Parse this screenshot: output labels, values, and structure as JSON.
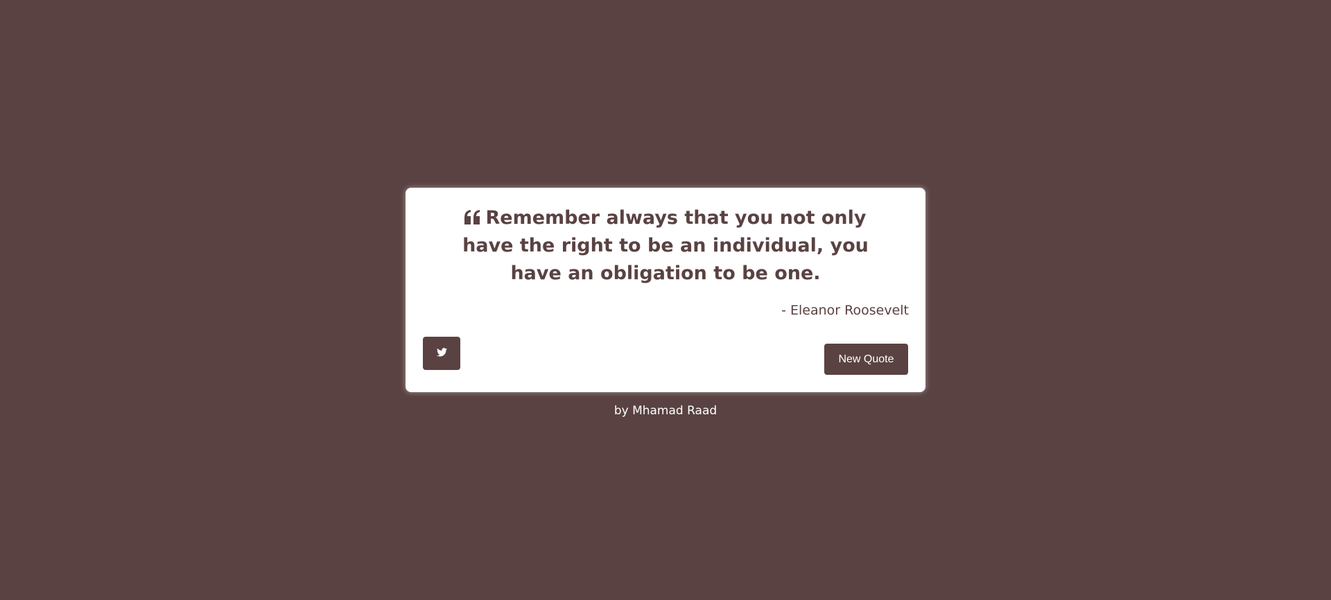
{
  "quote": {
    "text": "Remember always that you not only have the right to be an individual, you have an obligation to be one.",
    "author": "- Eleanor Roosevelt",
    "icon": "quote-left-icon"
  },
  "actions": {
    "tweet_icon": "twitter-icon",
    "new_quote_label": "New Quote"
  },
  "footer": {
    "credit": "by Mhamad Raad"
  },
  "colors": {
    "background": "#5a4242",
    "card": "#ffffff",
    "accent": "#5a4242"
  }
}
